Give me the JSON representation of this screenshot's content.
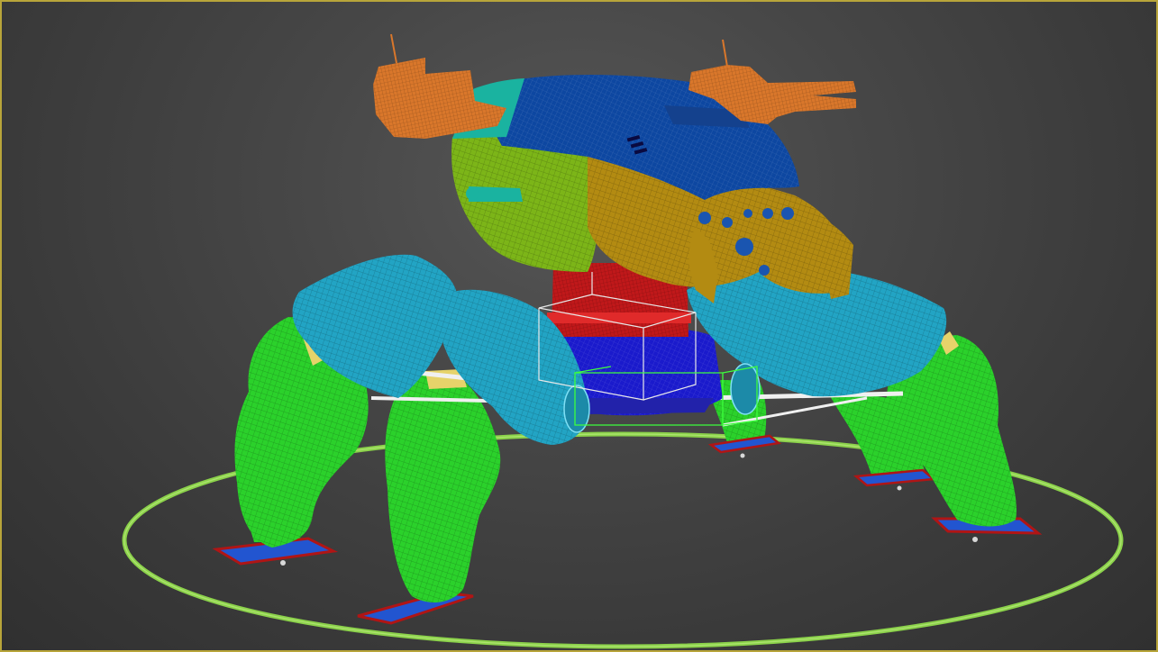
{
  "viewport": {
    "active": true,
    "border_color": "#b8a53a",
    "background_color": "#3a3a3a"
  },
  "scene": {
    "model": "quadruped-mech-robot",
    "display_mode": "wireframe",
    "colors": {
      "head_shell": "#0d47a1",
      "head_side": "#7cb518",
      "face_plate": "#b38b12",
      "turrets": "#d9772b",
      "neck": "#c0181a",
      "hip_core": "#1a1acc",
      "upper_legs": "#22a4c4",
      "lower_legs": "#2bd12b",
      "feet": "#2255d0",
      "foot_outline": "#b01515",
      "ground_ring": "#8bd24a",
      "accent_yellow": "#e6d36a",
      "bounding_box": "#e8e8e8",
      "gizmo": "#3cff3c"
    }
  }
}
